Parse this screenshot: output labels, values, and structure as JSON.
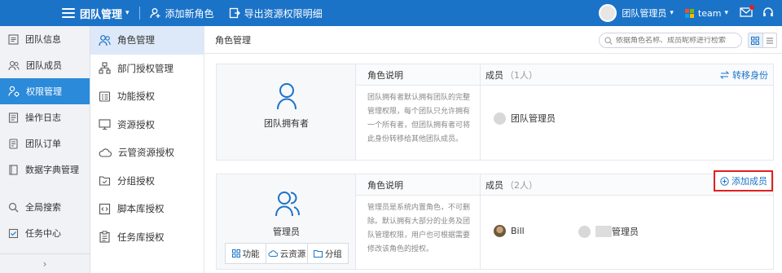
{
  "header": {
    "app_title": "团队管理",
    "actions": [
      {
        "label": "添加新角色",
        "icon": "user-add-icon"
      },
      {
        "label": "导出资源权限明细",
        "icon": "export-icon"
      }
    ],
    "user_name": "团队管理员",
    "team_name": "team"
  },
  "sidebar": {
    "items": [
      {
        "label": "团队信息",
        "icon": "team-info-icon"
      },
      {
        "label": "团队成员",
        "icon": "members-icon"
      },
      {
        "label": "权限管理",
        "icon": "permission-icon",
        "active": true
      },
      {
        "label": "操作日志",
        "icon": "log-icon"
      },
      {
        "label": "团队订单",
        "icon": "order-icon"
      },
      {
        "label": "数据字典管理",
        "icon": "dictionary-icon"
      },
      {
        "label": "全局搜索",
        "icon": "search-icon"
      },
      {
        "label": "任务中心",
        "icon": "task-icon"
      }
    ]
  },
  "submenu": {
    "items": [
      {
        "label": "角色管理",
        "icon": "role-icon",
        "active": true
      },
      {
        "label": "部门授权管理",
        "icon": "org-chart-icon"
      },
      {
        "label": "功能授权",
        "icon": "function-icon"
      },
      {
        "label": "资源授权",
        "icon": "monitor-icon"
      },
      {
        "label": "云管资源授权",
        "icon": "cloud-icon"
      },
      {
        "label": "分组授权",
        "icon": "folder-icon"
      },
      {
        "label": "脚本库授权",
        "icon": "script-icon"
      },
      {
        "label": "任务库授权",
        "icon": "clipboard-icon"
      }
    ]
  },
  "main": {
    "title": "角色管理",
    "search_placeholder": "依据角色名称、成员昵称进行检索"
  },
  "roles": [
    {
      "name": "团队拥有者",
      "desc_header": "角色说明",
      "description": "团队拥有者默认拥有团队的完整管理权限，每个团队只允许拥有一个所有者，但团队拥有者可将此身份转移给其他团队成员。",
      "members_header": "成员",
      "members_count": "（1人）",
      "action_label": "转移身份",
      "members": [
        "团队管理员"
      ]
    },
    {
      "name": "管理员",
      "desc_header": "角色说明",
      "description": "管理员是系统内置角色，不可删除。默认拥有大部分的业务及团队管理权限，用户也可根据需要修改该角色的授权。",
      "members_header": "成员",
      "members_count": "（2人）",
      "action_label": "添加成员",
      "members": [
        "Bill",
        "管理员"
      ],
      "perm_buttons": [
        "功能",
        "云资源",
        "分组"
      ]
    }
  ],
  "colors": {
    "topbar": "#1b73c8",
    "sidebar_active": "#2b8ad9",
    "highlight": "#e02020"
  }
}
